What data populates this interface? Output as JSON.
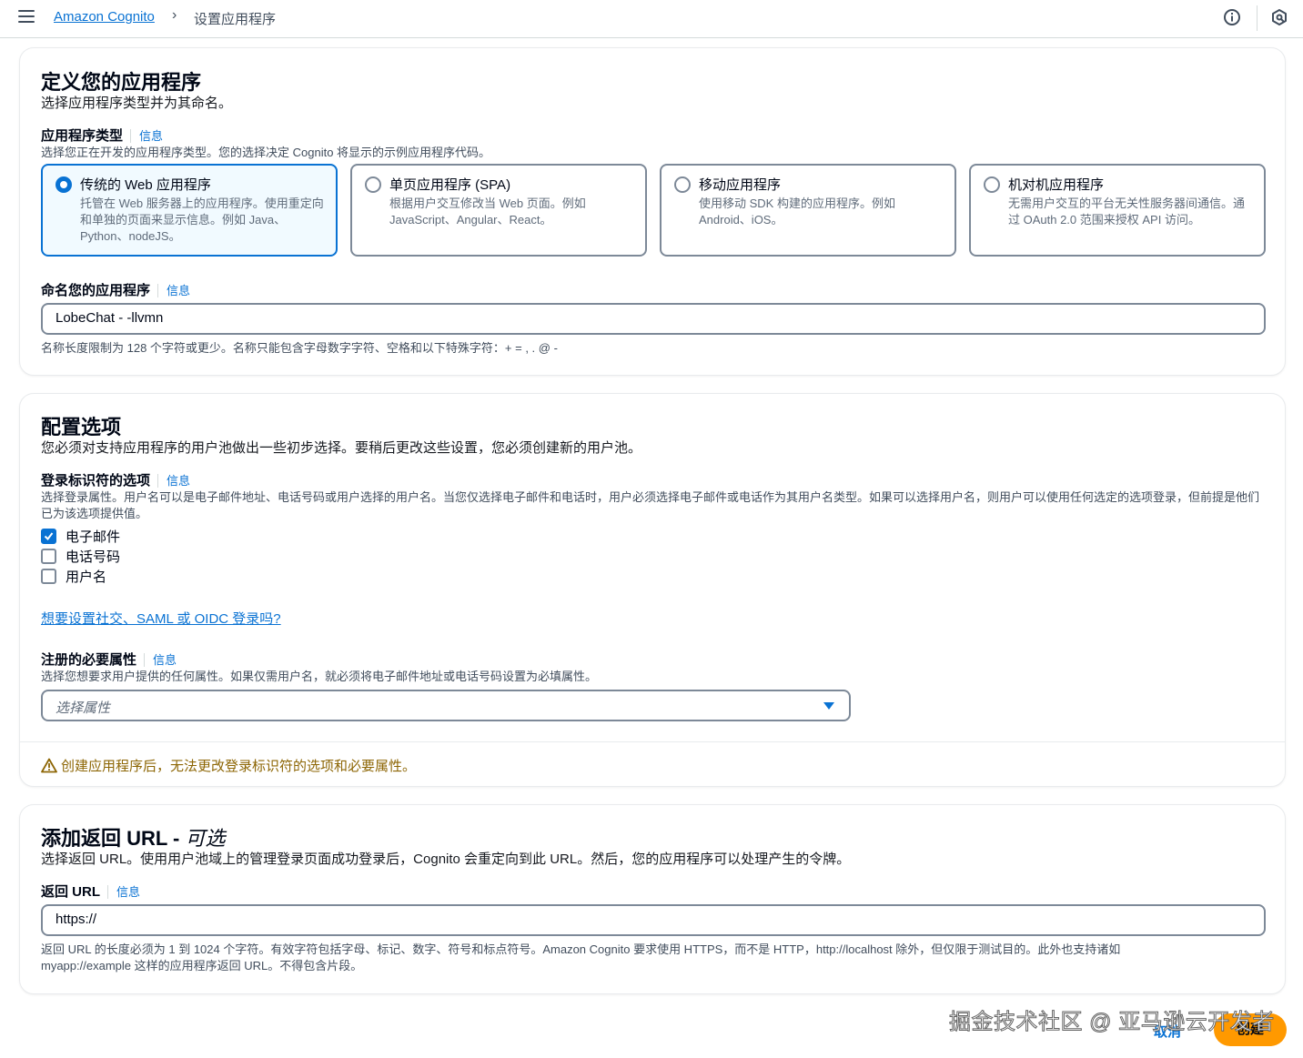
{
  "header": {
    "breadcrumb_service": "Amazon Cognito",
    "breadcrumb_separator": "›",
    "breadcrumb_current": "设置应用程序"
  },
  "define_app": {
    "title": "定义您的应用程序",
    "description": "选择应用程序类型并为其命名。",
    "type_label": "应用程序类型",
    "info": "信息",
    "type_description": "选择您正在开发的应用程序类型。您的选择决定 Cognito 将显示的示例应用程序代码。",
    "tiles": [
      {
        "title": "传统的 Web 应用程序",
        "description": "托管在 Web 服务器上的应用程序。使用重定向和单独的页面来显示信息。例如 Java、Python、nodeJS。",
        "selected": true
      },
      {
        "title": "单页应用程序 (SPA)",
        "description": "根据用户交互修改当 Web 页面。例如 JavaScript、Angular、React。",
        "selected": false
      },
      {
        "title": "移动应用程序",
        "description": "使用移动 SDK 构建的应用程序。例如 Android、iOS。",
        "selected": false
      },
      {
        "title": "机对机应用程序",
        "description": "无需用户交互的平台无关性服务器间通信。通过 OAuth 2.0 范围来授权 API 访问。",
        "selected": false
      }
    ],
    "name_label": "命名您的应用程序",
    "name_value": "LobeChat - -llvmn",
    "name_constraint": "名称长度限制为 128 个字符或更少。名称只能包含字母数字字符、空格和以下特殊字符：+ = , . @ -"
  },
  "config": {
    "title": "配置选项",
    "description": "您必须对支持应用程序的用户池做出一些初步选择。要稍后更改这些设置，您必须创建新的用户池。",
    "signin_label": "登录标识符的选项",
    "signin_description": "选择登录属性。用户名可以是电子邮件地址、电话号码或用户选择的用户名。当您仅选择电子邮件和电话时，用户必须选择电子邮件或电话作为其用户名类型。如果可以选择用户名，则用户可以使用任何选定的选项登录，但前提是他们已为该选项提供值。",
    "options": [
      {
        "label": "电子邮件",
        "checked": true
      },
      {
        "label": "电话号码",
        "checked": false
      },
      {
        "label": "用户名",
        "checked": false
      }
    ],
    "social_link": "想要设置社交、SAML 或 OIDC 登录吗?",
    "required_label": "注册的必要属性",
    "required_description": "选择您想要求用户提供的任何属性。如果仅需用户名，就必须将电子邮件地址或电话号码设置为必填属性。",
    "select_placeholder": "选择属性",
    "warning": "创建应用程序后，无法更改登录标识符的选项和必要属性。"
  },
  "return_url": {
    "title": "添加返回 URL - ",
    "title_optional": "可选",
    "description": "选择返回 URL。使用用户池域上的管理登录页面成功登录后，Cognito 会重定向到此 URL。然后，您的应用程序可以处理产生的令牌。",
    "label": "返回 URL",
    "value": "https://",
    "constraint": "返回 URL 的长度必须为 1 到 1024 个字符。有效字符包括字母、标记、数字、符号和标点符号。Amazon Cognito 要求使用 HTTPS，而不是 HTTP，http://localhost 除外，但仅限于测试目的。此外也支持诸如 myapp://example 这样的应用程序返回 URL。不得包含片段。"
  },
  "footer": {
    "cancel": "取消",
    "create": "创建",
    "watermark": "掘金技术社区 @ 亚马逊云开发者"
  },
  "colors": {
    "link": "#0972d3",
    "primary_button": "#ff9900",
    "warning_text": "#8d6605"
  },
  "icons": [
    "menu-icon",
    "info-circle-icon",
    "notification-icon",
    "warning-icon",
    "check-icon",
    "caret-down-icon"
  ]
}
